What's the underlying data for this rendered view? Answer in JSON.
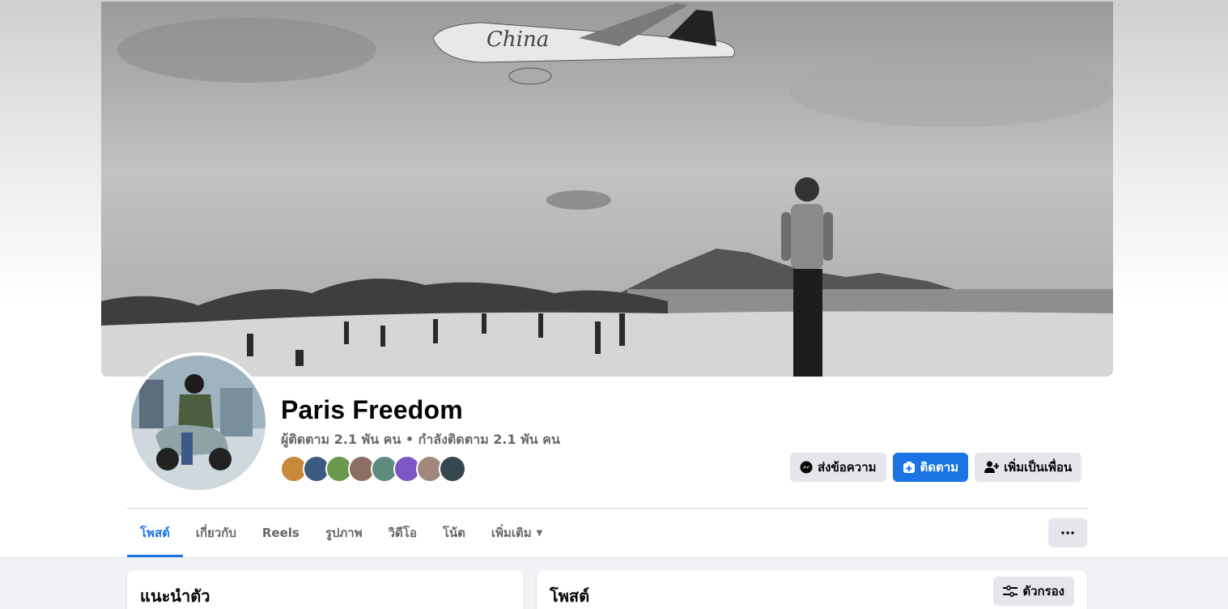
{
  "profile": {
    "name": "Paris Freedom",
    "stats": "ผู้ติดตาม 2.1 พัน คน • กำลังติดตาม 2.1 พัน คน"
  },
  "friends": [
    "#c88a3a",
    "#3d5a80",
    "#6a994e",
    "#8d6e63",
    "#5e8b7e",
    "#7e57c2",
    "#a1887f",
    "#37474f"
  ],
  "actions": {
    "message_label": "ส่งข้อความ",
    "follow_label": "ติดตาม",
    "add_friend_label": "เพิ่มเป็นเพื่อน"
  },
  "tabs": [
    {
      "label": "โพสต์"
    },
    {
      "label": "เกี่ยวกับ"
    },
    {
      "label": "Reels"
    },
    {
      "label": "รูปภาพ"
    },
    {
      "label": "วิดีโอ"
    },
    {
      "label": "โน้ต"
    },
    {
      "label": "เพิ่มเติม"
    }
  ],
  "intro_card": {
    "title": "แนะนำตัว"
  },
  "posts_card": {
    "title": "โพสต์",
    "filter_label": "ตัวกรอง"
  },
  "colors": {
    "accent": "#1b74e4",
    "button_gray": "#e4e6eb",
    "text_secondary": "#65676b"
  }
}
